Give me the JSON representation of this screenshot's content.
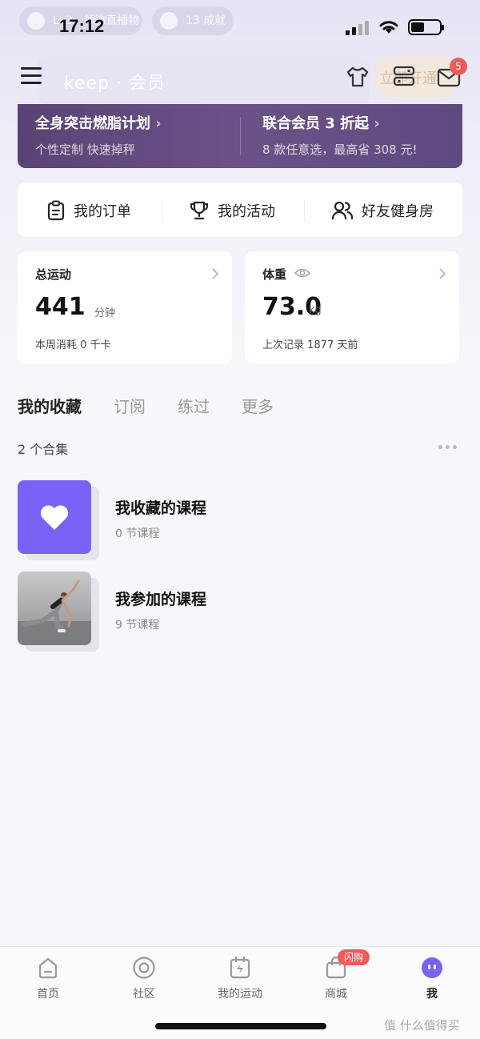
{
  "status_bar": {
    "time": "17:12",
    "pill_left": "Lv3 · 领物直播物",
    "pill_right": "13 成就"
  },
  "header": {
    "brand": "keep · 会员",
    "open_label": "立即开通",
    "unread_count": "5"
  },
  "banner": {
    "left_title": "全身突击燃脂计划",
    "left_sub": "个性定制 快速掉秤",
    "right_title": "联合会员 3 折起",
    "right_sub": "8 款任意选，最高省 308 元!"
  },
  "shortcuts": [
    {
      "label": "我的订单",
      "icon": "clipboard-icon"
    },
    {
      "label": "我的活动",
      "icon": "trophy-icon"
    },
    {
      "label": "好友健身房",
      "icon": "friends-icon"
    }
  ],
  "stats": {
    "exercise": {
      "label": "总运动",
      "value": "441",
      "unit": "分钟",
      "sub": "本周消耗 0 千卡"
    },
    "weight": {
      "label": "体重",
      "value": "73.0",
      "unit": "kg",
      "sub": "上次记录 1877 天前"
    }
  },
  "tabs": [
    "我的收藏",
    "订阅",
    "练过",
    "更多"
  ],
  "collections": {
    "count_text": "2 个合集",
    "items": [
      {
        "title": "我收藏的课程",
        "meta": "0 节课程"
      },
      {
        "title": "我参加的课程",
        "meta": "9 节课程"
      }
    ]
  },
  "tabbar": {
    "items": [
      "首页",
      "社区",
      "我的运动",
      "商城",
      "我"
    ],
    "flash_badge": "闪购"
  },
  "watermark": "值 什么值得买",
  "colors": {
    "accent": "#7b61f5",
    "banner": "#5a4374",
    "badge": "#ef5b5b"
  }
}
